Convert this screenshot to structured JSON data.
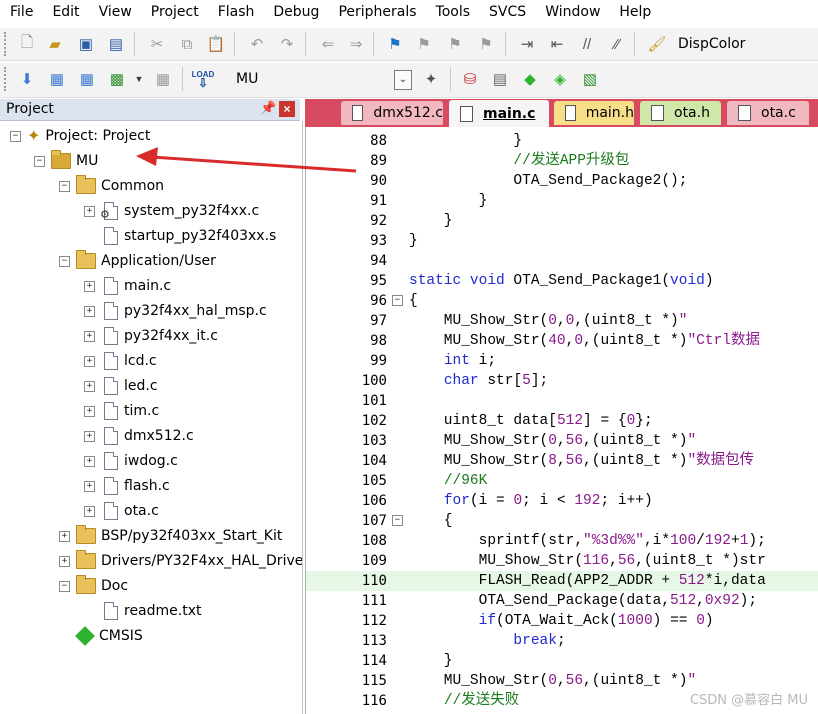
{
  "menubar": [
    "File",
    "Edit",
    "View",
    "Project",
    "Flash",
    "Debug",
    "Peripherals",
    "Tools",
    "SVCS",
    "Window",
    "Help"
  ],
  "toolbar": {
    "disp_color_label": "DispColor",
    "load_label": "LOAD",
    "target": "MU"
  },
  "project_panel": {
    "title": "Project",
    "tree": [
      {
        "label": "Project: Project",
        "level": 0,
        "kind": "project",
        "expander": "−"
      },
      {
        "label": "MU",
        "level": 1,
        "kind": "target",
        "expander": "−"
      },
      {
        "label": "Common",
        "level": 2,
        "kind": "folder",
        "expander": "−"
      },
      {
        "label": "system_py32f4xx.c",
        "level": 3,
        "kind": "file-gear",
        "expander": "+"
      },
      {
        "label": "startup_py32f403xx.s",
        "level": 3,
        "kind": "file",
        "expander": ""
      },
      {
        "label": "Application/User",
        "level": 2,
        "kind": "folder",
        "expander": "−"
      },
      {
        "label": "main.c",
        "level": 3,
        "kind": "file",
        "expander": "+"
      },
      {
        "label": "py32f4xx_hal_msp.c",
        "level": 3,
        "kind": "file",
        "expander": "+"
      },
      {
        "label": "py32f4xx_it.c",
        "level": 3,
        "kind": "file",
        "expander": "+"
      },
      {
        "label": "lcd.c",
        "level": 3,
        "kind": "file",
        "expander": "+"
      },
      {
        "label": "led.c",
        "level": 3,
        "kind": "file",
        "expander": "+"
      },
      {
        "label": "tim.c",
        "level": 3,
        "kind": "file",
        "expander": "+"
      },
      {
        "label": "dmx512.c",
        "level": 3,
        "kind": "file",
        "expander": "+"
      },
      {
        "label": "iwdog.c",
        "level": 3,
        "kind": "file",
        "expander": "+"
      },
      {
        "label": "flash.c",
        "level": 3,
        "kind": "file",
        "expander": "+"
      },
      {
        "label": "ota.c",
        "level": 3,
        "kind": "file",
        "expander": "+"
      },
      {
        "label": "BSP/py32f403xx_Start_Kit",
        "level": 2,
        "kind": "folder",
        "expander": "+"
      },
      {
        "label": "Drivers/PY32F4xx_HAL_Drive",
        "level": 2,
        "kind": "folder",
        "expander": "+"
      },
      {
        "label": "Doc",
        "level": 2,
        "kind": "folder",
        "expander": "−"
      },
      {
        "label": "readme.txt",
        "level": 3,
        "kind": "file",
        "expander": ""
      },
      {
        "label": "CMSIS",
        "level": 2,
        "kind": "cmsis",
        "expander": ""
      }
    ]
  },
  "tabs": [
    {
      "label": "dmx512.c",
      "color": "#f2b8c0",
      "active": false
    },
    {
      "label": "main.c",
      "color": "#f5f5f5",
      "active": true
    },
    {
      "label": "main.h",
      "color": "#f7df8a",
      "active": false
    },
    {
      "label": "ota.h",
      "color": "#cfe7a9",
      "active": false
    },
    {
      "label": "ota.c",
      "color": "#f2b8c0",
      "active": false
    }
  ],
  "editor": {
    "highlight_line": 110,
    "lines": [
      {
        "n": "88",
        "fold": "",
        "html": "            }"
      },
      {
        "n": "89",
        "fold": "",
        "html": "            <span class='cm'>//发送APP升级包</span>"
      },
      {
        "n": "90",
        "fold": "",
        "html": "            OTA_Send_Package2();"
      },
      {
        "n": "91",
        "fold": "",
        "html": "        }"
      },
      {
        "n": "92",
        "fold": "",
        "html": "    }"
      },
      {
        "n": "93",
        "fold": "",
        "html": "}"
      },
      {
        "n": "94",
        "fold": "",
        "html": ""
      },
      {
        "n": "95",
        "fold": "",
        "html": "<span class='kw'>static void</span> OTA_Send_Package1(<span class='kw'>void</span>)"
      },
      {
        "n": "96",
        "fold": "−",
        "html": "{"
      },
      {
        "n": "97",
        "fold": "",
        "html": "    MU_Show_Str(<span class='num'>0</span>,<span class='num'>0</span>,(uint8_t *)<span class='str'>\"</span>"
      },
      {
        "n": "98",
        "fold": "",
        "html": "    MU_Show_Str(<span class='num'>40</span>,<span class='num'>0</span>,(uint8_t *)<span class='str'>\"Ctrl数据</span>"
      },
      {
        "n": "99",
        "fold": "",
        "html": "    <span class='kw'>int</span> i;"
      },
      {
        "n": "100",
        "fold": "",
        "html": "    <span class='kw'>char</span> str[<span class='num'>5</span>];"
      },
      {
        "n": "101",
        "fold": "",
        "html": ""
      },
      {
        "n": "102",
        "fold": "",
        "html": "    uint8_t data[<span class='num'>512</span>] = {<span class='num'>0</span>};"
      },
      {
        "n": "103",
        "fold": "",
        "html": "    MU_Show_Str(<span class='num'>0</span>,<span class='num'>56</span>,(uint8_t *)<span class='str'>\"</span>"
      },
      {
        "n": "104",
        "fold": "",
        "html": "    MU_Show_Str(<span class='num'>8</span>,<span class='num'>56</span>,(uint8_t *)<span class='str'>\"数据包传</span>"
      },
      {
        "n": "105",
        "fold": "",
        "html": "    <span class='cm'>//96K</span>"
      },
      {
        "n": "106",
        "fold": "",
        "html": "    <span class='kw'>for</span>(i = <span class='num'>0</span>; i &lt; <span class='num'>192</span>; i++)"
      },
      {
        "n": "107",
        "fold": "−",
        "html": "    {"
      },
      {
        "n": "108",
        "fold": "",
        "html": "        sprintf(str,<span class='str'>\"%3d%%\"</span>,i*<span class='num'>100</span>/<span class='num'>192</span>+<span class='num'>1</span>);"
      },
      {
        "n": "109",
        "fold": "",
        "html": "        MU_Show_Str(<span class='num'>116</span>,<span class='num'>56</span>,(uint8_t *)str"
      },
      {
        "n": "110",
        "fold": "",
        "html": "        FLASH_Read(APP2_ADDR + <span class='num'>512</span>*i,data"
      },
      {
        "n": "111",
        "fold": "",
        "html": "        OTA_Send_Package(data,<span class='num'>512</span>,<span class='num'>0x92</span>);"
      },
      {
        "n": "112",
        "fold": "",
        "html": "        <span class='kw'>if</span>(OTA_Wait_Ack(<span class='num'>1000</span>) == <span class='num'>0</span>)"
      },
      {
        "n": "113",
        "fold": "",
        "html": "            <span class='kw'>break</span>;"
      },
      {
        "n": "114",
        "fold": "",
        "html": "    }"
      },
      {
        "n": "115",
        "fold": "",
        "html": "    MU_Show_Str(<span class='num'>0</span>,<span class='num'>56</span>,(uint8_t *)<span class='str'>\"</span>"
      },
      {
        "n": "116",
        "fold": "",
        "html": "    <span class='cm'>//发送失败</span>"
      }
    ]
  },
  "watermark": "CSDN @慕容白 MU",
  "colors": {
    "tabbar": "#d84a5f",
    "arrow": "#d92b2b",
    "keyword": "#1f2bd1",
    "comment": "#1a7a1a",
    "string": "#8a1a8a",
    "highlight": "#e6f7e6"
  }
}
